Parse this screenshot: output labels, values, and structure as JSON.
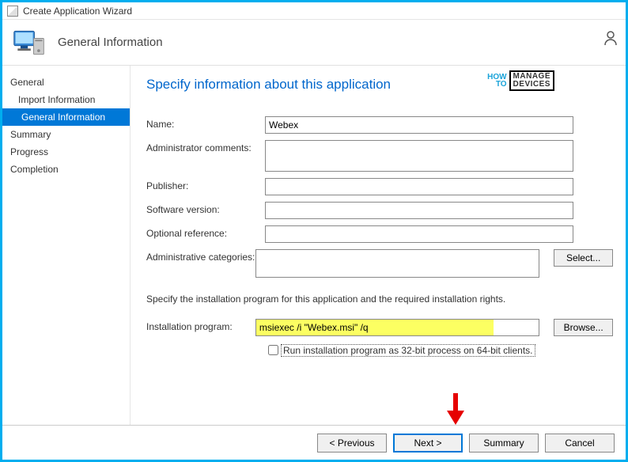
{
  "window": {
    "title": "Create Application Wizard"
  },
  "header": {
    "title": "General Information"
  },
  "sidebar": {
    "items": [
      {
        "label": "General"
      },
      {
        "label": "Import Information"
      },
      {
        "label": "General Information"
      },
      {
        "label": "Summary"
      },
      {
        "label": "Progress"
      },
      {
        "label": "Completion"
      }
    ]
  },
  "page": {
    "heading": "Specify information about this application",
    "logo": {
      "how": "HOW",
      "to": "TO",
      "line1": "MANAGE",
      "line2": "DEVICES"
    },
    "fields": {
      "name_label": "Name:",
      "name_value": "Webex",
      "admin_comments_label": "Administrator comments:",
      "admin_comments_value": "",
      "publisher_label": "Publisher:",
      "publisher_value": "",
      "version_label": "Software version:",
      "version_value": "",
      "optref_label": "Optional reference:",
      "optref_value": "",
      "cat_label": "Administrative categories:",
      "select_btn": "Select...",
      "install_desc": "Specify the installation program for this application and the required installation rights.",
      "install_label": "Installation program:",
      "install_value": "msiexec /i \"Webex.msi\" /q",
      "browse_btn": "Browse...",
      "run32_label": "Run installation program as 32-bit process on 64-bit clients."
    }
  },
  "footer": {
    "previous": "< Previous",
    "next": "Next >",
    "summary": "Summary",
    "cancel": "Cancel"
  }
}
